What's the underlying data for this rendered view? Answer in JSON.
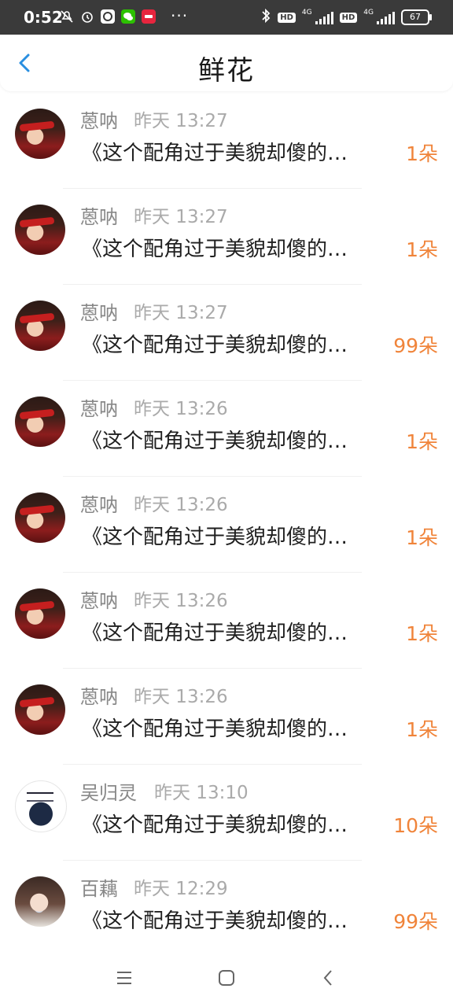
{
  "status_bar": {
    "time": "0:52",
    "icons": [
      "mute-icon",
      "alarm-icon",
      "app-icon",
      "wechat-icon",
      "app-badge-icon"
    ],
    "more": "···",
    "hd1": "HD",
    "net1": "4G",
    "hd2": "HD",
    "net2": "4G",
    "battery": "67"
  },
  "header": {
    "title": "鲜花"
  },
  "colors": {
    "accent_orange": "#f0843a",
    "back_blue": "#2a8fe0",
    "status_bg": "#3a3a3a"
  },
  "items": [
    {
      "name": "蒽呐",
      "time": "昨天 13:27",
      "message": "《这个配角过于美貌却傻的…",
      "count": "1朵",
      "avatar": "girl"
    },
    {
      "name": "蒽呐",
      "time": "昨天 13:27",
      "message": "《这个配角过于美貌却傻的…",
      "count": "1朵",
      "avatar": "girl"
    },
    {
      "name": "蒽呐",
      "time": "昨天 13:27",
      "message": "《这个配角过于美貌却傻的…",
      "count": "99朵",
      "avatar": "girl"
    },
    {
      "name": "蒽呐",
      "time": "昨天 13:26",
      "message": "《这个配角过于美貌却傻的…",
      "count": "1朵",
      "avatar": "girl"
    },
    {
      "name": "蒽呐",
      "time": "昨天 13:26",
      "message": "《这个配角过于美貌却傻的…",
      "count": "1朵",
      "avatar": "girl"
    },
    {
      "name": "蒽呐",
      "time": "昨天 13:26",
      "message": "《这个配角过于美貌却傻的…",
      "count": "1朵",
      "avatar": "girl"
    },
    {
      "name": "蒽呐",
      "time": "昨天 13:26",
      "message": "《这个配角过于美貌却傻的…",
      "count": "1朵",
      "avatar": "girl"
    },
    {
      "name": "吴归灵",
      "time": "昨天 13:10",
      "message": "《这个配角过于美貌却傻的…",
      "count": "10朵",
      "avatar": "bw"
    },
    {
      "name": "百藕",
      "time": "昨天 12:29",
      "message": "《这个配角过于美貌却傻的…",
      "count": "99朵",
      "avatar": "selfie"
    }
  ],
  "nav": {
    "menu_icon": "menu-icon",
    "home_icon": "home-icon",
    "back_icon": "back-icon"
  }
}
